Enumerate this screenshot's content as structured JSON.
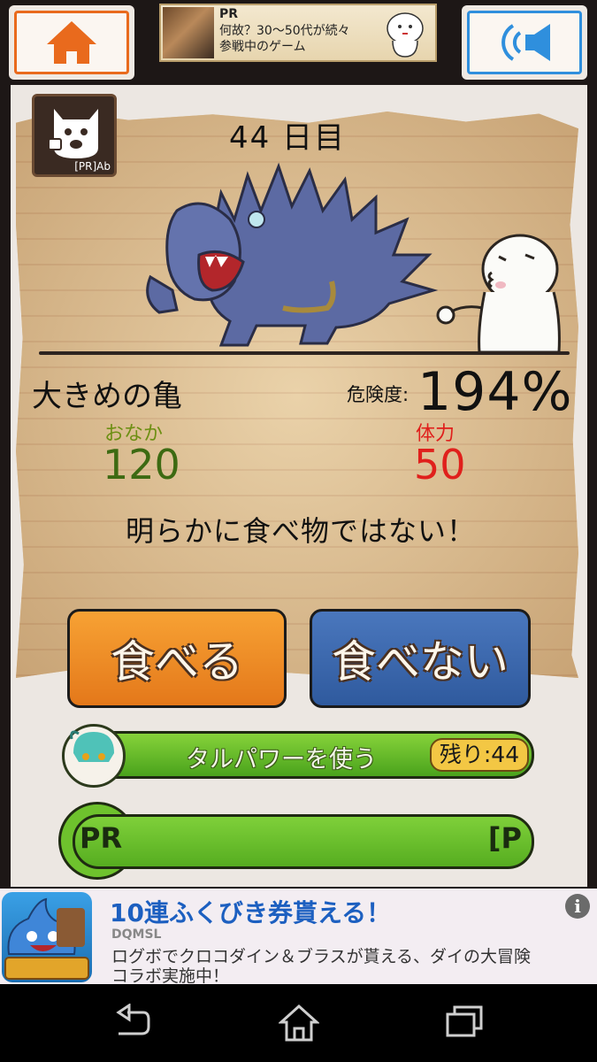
{
  "top_bar": {
    "home_icon": "home-icon",
    "sound_icon": "speaker-icon",
    "ad": {
      "label": "PR",
      "line1": "何故？30～50代が続々",
      "line2": "参戦中のゲーム"
    }
  },
  "app_icon": {
    "label": "[PR]Ab"
  },
  "game": {
    "day": "44 日目",
    "enemy_name": "大きめの亀",
    "danger_label": "危険度:",
    "danger_value": "194%",
    "hunger_label": "おなか",
    "hunger_value": "120",
    "hp_label": "体力",
    "hp_value": "50",
    "message": "明らかに食べ物ではない！"
  },
  "actions": {
    "eat": "食べる",
    "not_eat": "食べない"
  },
  "power": {
    "label": "タルパワーを使う",
    "remaining": "残り:44"
  },
  "pr_bar": {
    "left": "PR",
    "right": "[P"
  },
  "bottom_ad": {
    "headline": "10連ふくびき券貰える！",
    "brand": "DQMSL",
    "desc_line1": "ログボでクロコダイン＆ブラスが貰える、ダイの大冒険",
    "desc_line2": "コラボ実施中！",
    "info_glyph": "i"
  },
  "colors": {
    "home_accent": "#e96a1d",
    "sound_accent": "#2f8fdd",
    "hunger": "#3d6a12",
    "hp": "#e0201c",
    "eat_button": "#f09028",
    "not_eat_button": "#3f6cb3",
    "power_bar": "#6cc22d",
    "ad_headline": "#1c5fc0"
  }
}
